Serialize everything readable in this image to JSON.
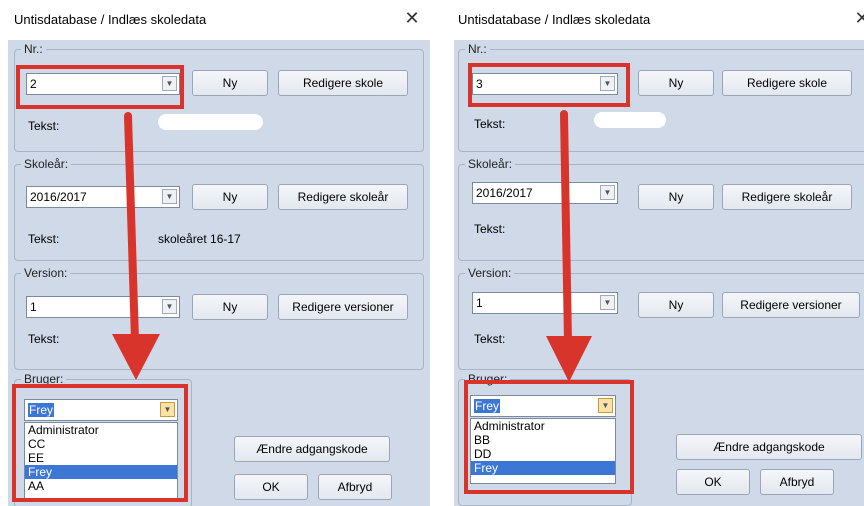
{
  "left": {
    "title": "Untisdatabase / Indlæs skoledata",
    "close_glyph": "✕",
    "nr": {
      "legend": "Nr.:",
      "value": "2",
      "new_label": "Ny",
      "edit_label": "Redigere skole",
      "text_label": "Tekst:"
    },
    "year": {
      "legend": "Skoleår:",
      "value": "2016/2017",
      "new_label": "Ny",
      "edit_label": "Redigere skoleår",
      "text_label": "Tekst:",
      "text_value": "skoleåret 16-17"
    },
    "version": {
      "legend": "Version:",
      "value": "1",
      "new_label": "Ny",
      "edit_label": "Redigere versioner",
      "text_label": "Tekst:"
    },
    "user": {
      "legend": "Bruger:",
      "value": "Frey",
      "options": [
        "Administrator",
        "CC",
        "EE",
        "Frey",
        "AA"
      ],
      "selected": "Frey"
    },
    "change_pw_label": "Ændre adgangskode",
    "ok_label": "OK",
    "cancel_label": "Afbryd"
  },
  "right": {
    "title": "Untisdatabase / Indlæs skoledata",
    "close_glyph": "✕",
    "nr": {
      "legend": "Nr.:",
      "value": "3",
      "new_label": "Ny",
      "edit_label": "Redigere skole",
      "text_label": "Tekst:"
    },
    "year": {
      "legend": "Skoleår:",
      "value": "2016/2017",
      "new_label": "Ny",
      "edit_label": "Redigere skoleår",
      "text_label": "Tekst:"
    },
    "version": {
      "legend": "Version:",
      "value": "1",
      "new_label": "Ny",
      "edit_label": "Redigere versioner",
      "text_label": "Tekst:"
    },
    "user": {
      "legend": "Bruger:",
      "value": "Frey",
      "options": [
        "Administrator",
        "BB",
        "DD",
        "Frey"
      ],
      "selected": "Frey"
    },
    "change_pw_label": "Ændre adgangskode",
    "ok_label": "OK",
    "cancel_label": "Afbryd"
  },
  "colors": {
    "annotation_red": "#d9342b",
    "dialog_bg": "#cfd9e8",
    "selection_blue": "#3d77d6"
  }
}
